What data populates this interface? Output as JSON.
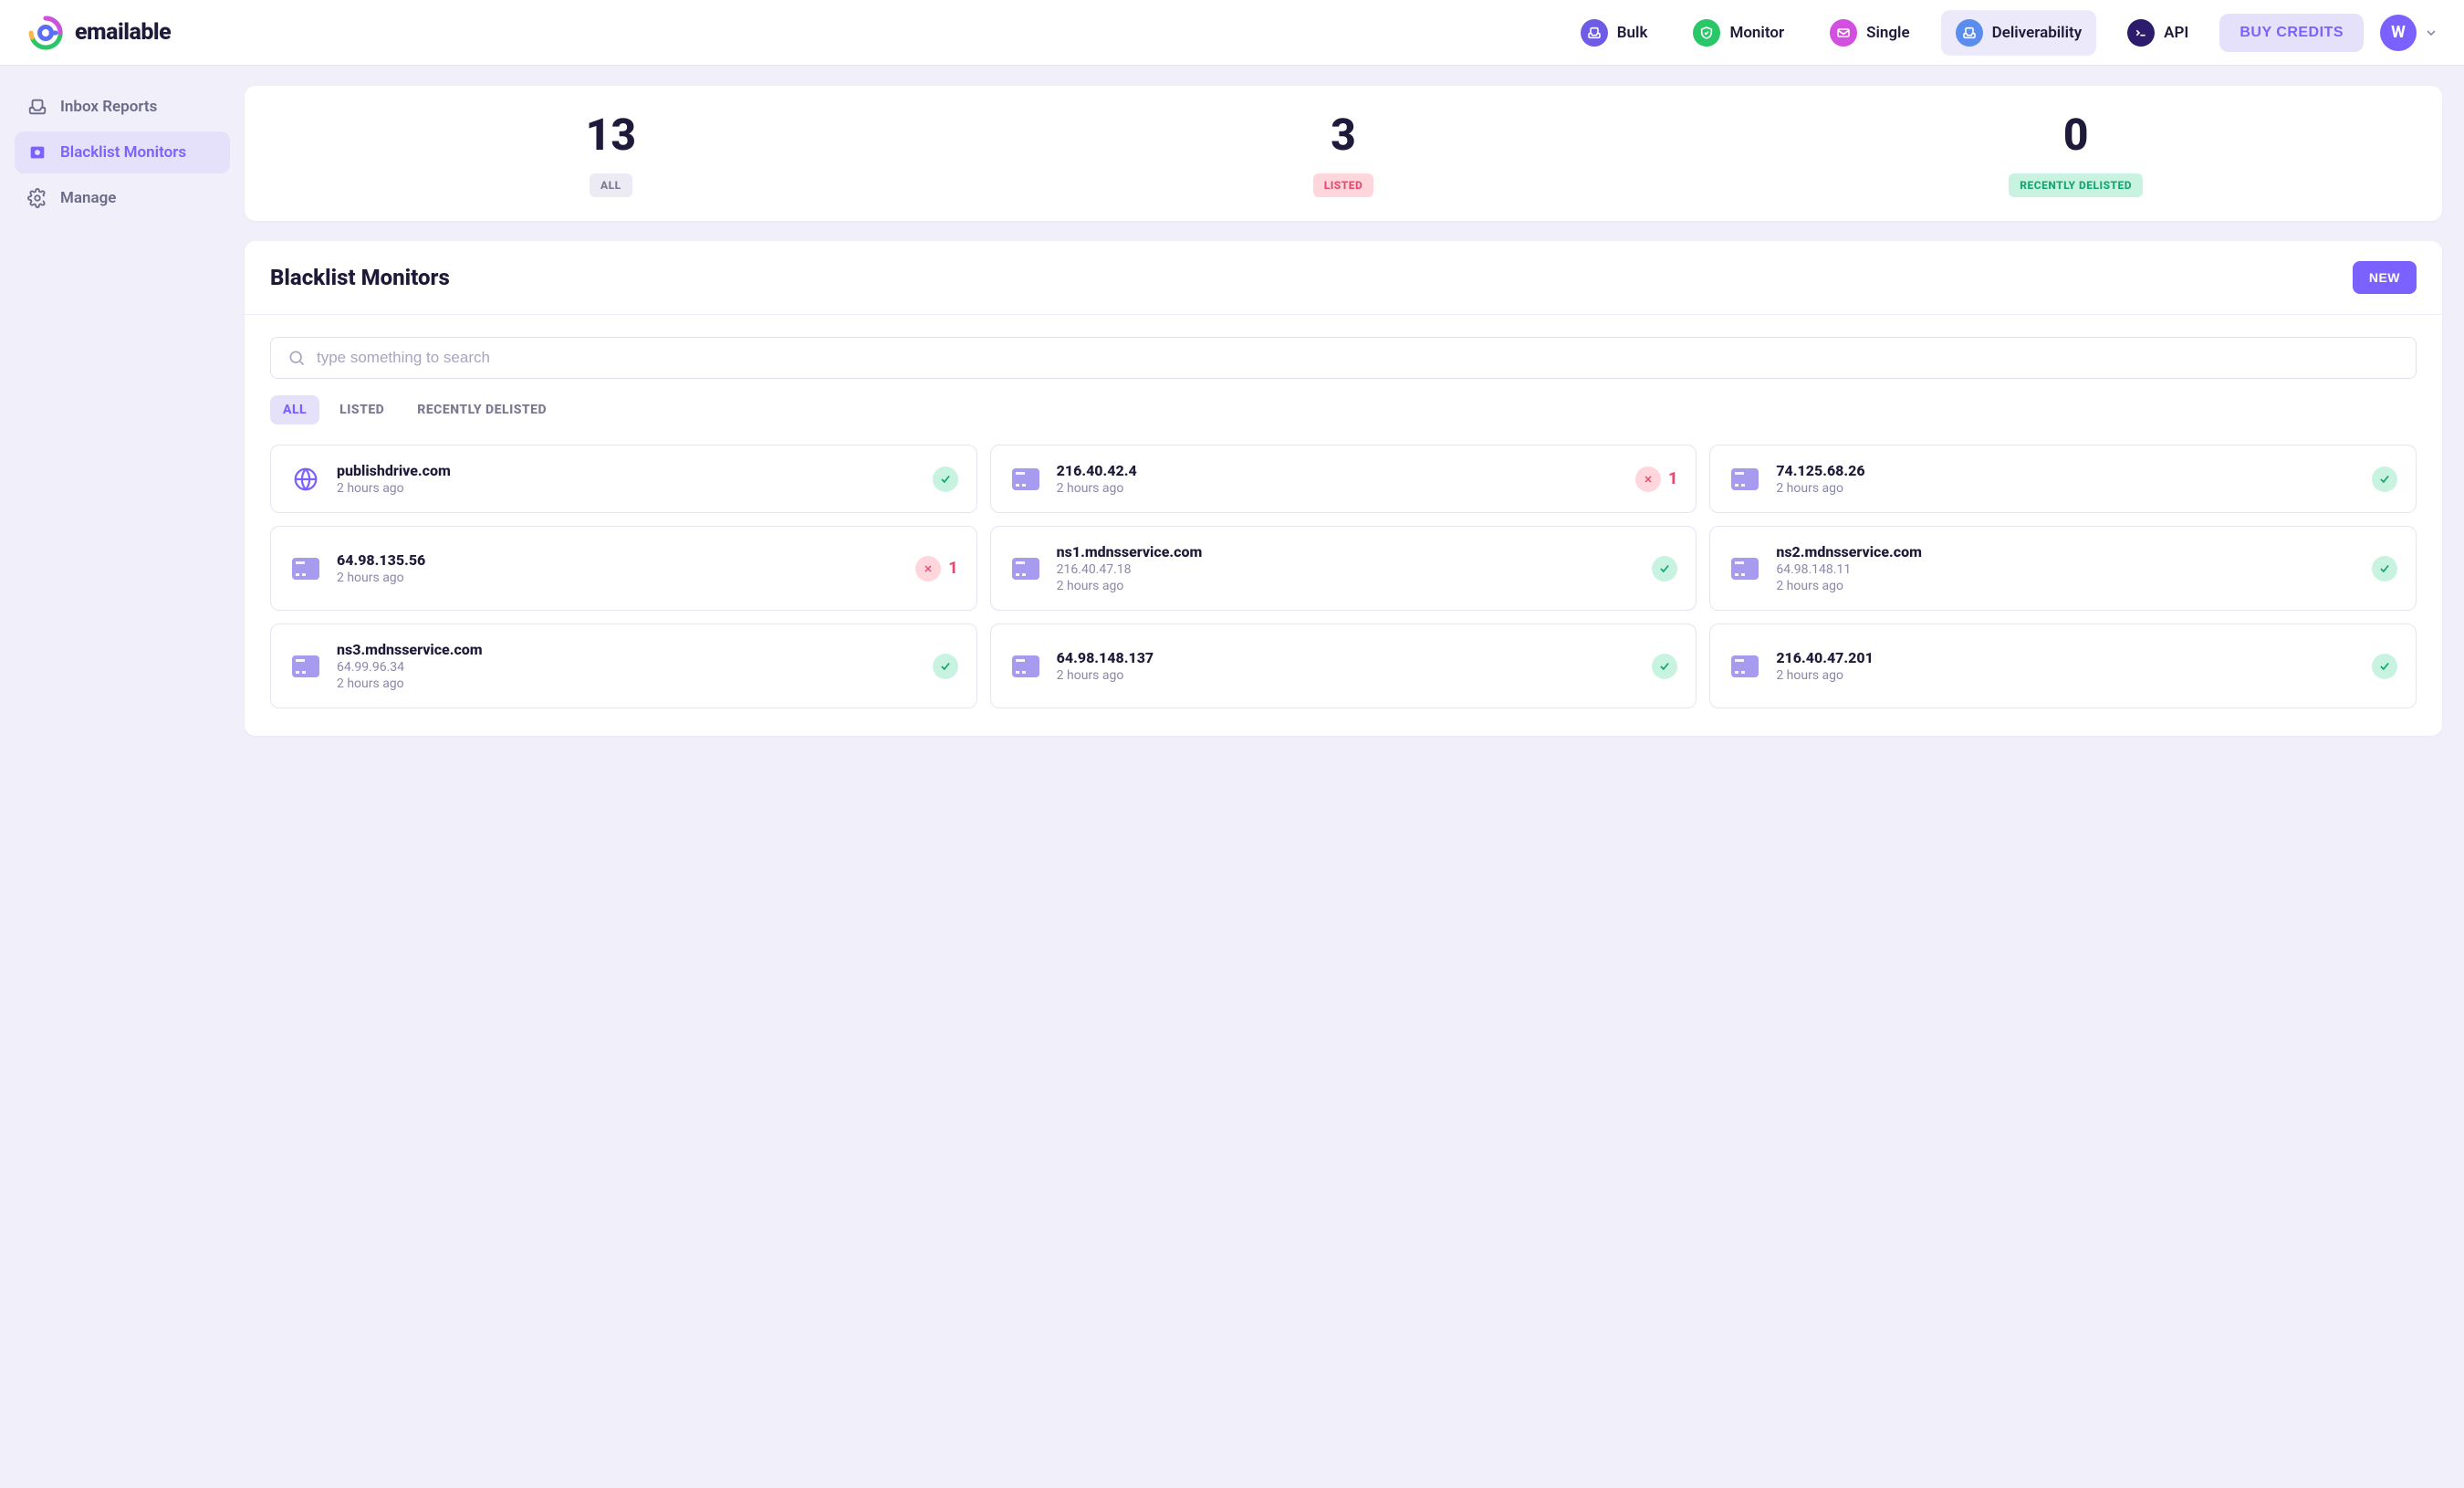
{
  "brand": "emailable",
  "header": {
    "nav": [
      {
        "key": "bulk",
        "label": "Bulk",
        "icon": "tray-icon",
        "color": "bg-purple"
      },
      {
        "key": "monitor",
        "label": "Monitor",
        "icon": "shield-icon",
        "color": "bg-green"
      },
      {
        "key": "single",
        "label": "Single",
        "icon": "mail-icon",
        "color": "bg-pink"
      },
      {
        "key": "deliver",
        "label": "Deliverability",
        "icon": "inbox-icon",
        "color": "bg-blue",
        "active": true
      },
      {
        "key": "api",
        "label": "API",
        "icon": "terminal-icon",
        "color": "bg-navy"
      }
    ],
    "buy_credits": "BUY CREDITS",
    "avatar_initial": "W"
  },
  "sidebar": {
    "items": [
      {
        "key": "inbox",
        "label": "Inbox Reports",
        "icon": "tray-icon"
      },
      {
        "key": "blacklist",
        "label": "Blacklist Monitors",
        "icon": "blacklist-icon",
        "active": true
      },
      {
        "key": "manage",
        "label": "Manage",
        "icon": "gear-icon"
      }
    ]
  },
  "stats": [
    {
      "value": "13",
      "label": "ALL",
      "badge": "badge-gray"
    },
    {
      "value": "3",
      "label": "LISTED",
      "badge": "badge-red"
    },
    {
      "value": "0",
      "label": "RECENTLY DELISTED",
      "badge": "badge-green-lt"
    }
  ],
  "panel": {
    "title": "Blacklist Monitors",
    "new_label": "NEW",
    "search_placeholder": "type something to search",
    "filters": [
      {
        "label": "ALL",
        "active": true
      },
      {
        "label": "LISTED"
      },
      {
        "label": "RECENTLY DELISTED"
      }
    ]
  },
  "monitors": [
    {
      "type": "domain",
      "name": "publishdrive.com",
      "sub": "",
      "time": "2 hours ago",
      "status": "ok"
    },
    {
      "type": "ip",
      "name": "216.40.42.4",
      "sub": "",
      "time": "2 hours ago",
      "status": "bad",
      "count": "1"
    },
    {
      "type": "ip",
      "name": "74.125.68.26",
      "sub": "",
      "time": "2 hours ago",
      "status": "ok"
    },
    {
      "type": "ip",
      "name": "64.98.135.56",
      "sub": "",
      "time": "2 hours ago",
      "status": "bad",
      "count": "1"
    },
    {
      "type": "ip",
      "name": "ns1.mdnsservice.com",
      "sub": "216.40.47.18",
      "time": "2 hours ago",
      "status": "ok"
    },
    {
      "type": "ip",
      "name": "ns2.mdnsservice.com",
      "sub": "64.98.148.11",
      "time": "2 hours ago",
      "status": "ok"
    },
    {
      "type": "ip",
      "name": "ns3.mdnsservice.com",
      "sub": "64.99.96.34",
      "time": "2 hours ago",
      "status": "ok"
    },
    {
      "type": "ip",
      "name": "64.98.148.137",
      "sub": "",
      "time": "2 hours ago",
      "status": "ok"
    },
    {
      "type": "ip",
      "name": "216.40.47.201",
      "sub": "",
      "time": "2 hours ago",
      "status": "ok"
    }
  ]
}
